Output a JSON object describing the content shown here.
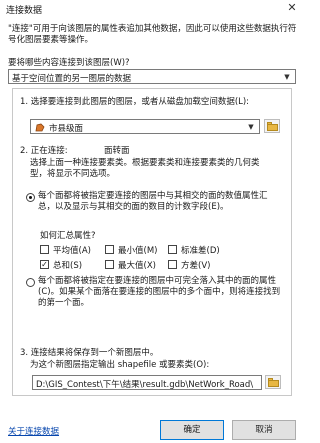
{
  "window": {
    "title": "连接数据"
  },
  "intro": "\"连接\"可用于向该图层的属性表追加其他数据，因此可以使用这些数据执行符号化图层要素等操作。",
  "join_type": {
    "prompt": "要将哪些内容连接到该图层(W)?",
    "selected": "基于空间位置的另一图层的数据"
  },
  "step1": {
    "label": "1. 选择要连接到此图层的图层，或者从磁盘加载空间数据(L):",
    "layer": "市县级面"
  },
  "step2": {
    "label": "2. 正在连接:",
    "target_layer": "面转面",
    "description": "选择上面一种连接要素类。根据要素类和连接要素类的几何类型，将显示不同选项。",
    "option_summarize": {
      "text": "每个面都将被指定要连接的图层中与其相交的面的数值属性汇总，以及显示与其相交的面的数目的计数字段(E)。",
      "selected": true
    },
    "summary_prompt": "如何汇总属性?",
    "summaries": [
      {
        "label": "平均值(A)",
        "checked": false
      },
      {
        "label": "最小值(M)",
        "checked": false
      },
      {
        "label": "标准差(D)",
        "checked": false
      },
      {
        "label": "总和(S)",
        "checked": true
      },
      {
        "label": "最大值(X)",
        "checked": false
      },
      {
        "label": "方差(V)",
        "checked": false
      }
    ],
    "option_within": {
      "text": "每个面都将被指定在要连接的图层中可完全落入其中的面的属性(C)。如果某个面落在要连接的图层中的多个面中，则将连接找到的第一个面。",
      "selected": false
    }
  },
  "step3": {
    "label": "3. 连接结果将保存到一个新图层中。",
    "sublabel": "为这个新图层指定输出 shapefile 或要素类(O):",
    "output_path": "D:\\GIS_Contest\\下午\\结果\\result.gdb\\NetWork_Road\\"
  },
  "footer": {
    "link": "关于连接数据",
    "ok": "确定",
    "cancel": "取消"
  },
  "colors": {
    "accent": "#0078d7",
    "link": "#0645ad",
    "layer_icon": "#d9772b"
  }
}
